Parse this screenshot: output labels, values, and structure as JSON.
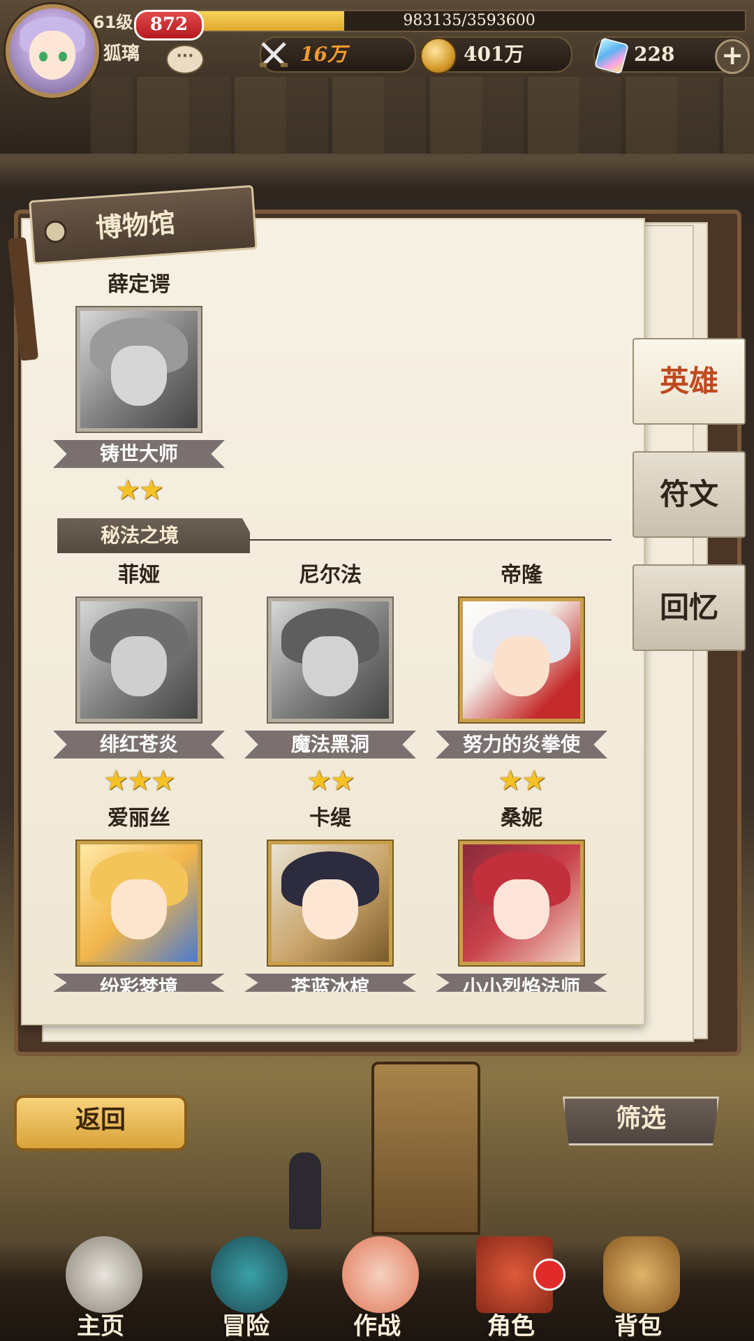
{
  "player": {
    "level": "61级",
    "power_badge": "872",
    "name": "狐璃",
    "exp_text": "983135/3593600",
    "exp_fraction": 0.2736
  },
  "resources": {
    "battle_power": "16万",
    "gold": "401万",
    "gems": "228",
    "add_label": "+"
  },
  "museum": {
    "title": "博物馆",
    "featured": {
      "name": "薛定谔",
      "title": "铸世大师",
      "stars": "★★"
    },
    "section_title": "秘法之境",
    "heroes": [
      {
        "name": "菲娅",
        "title": "绯红苍炎",
        "stars": "★★★"
      },
      {
        "name": "尼尔法",
        "title": "魔法黑洞",
        "stars": "★★"
      },
      {
        "name": "帝隆",
        "title": "努力的炎拳使",
        "stars": "★★"
      },
      {
        "name": "爱丽丝",
        "title": "纷彩梦境",
        "stars": ""
      },
      {
        "name": "卡缇",
        "title": "苍蓝冰棺",
        "stars": ""
      },
      {
        "name": "桑妮",
        "title": "小小烈焰法师",
        "stars": ""
      }
    ]
  },
  "tabs": [
    "英雄",
    "符文",
    "回忆"
  ],
  "buttons": {
    "back": "返回",
    "filter": "筛选"
  },
  "nav": [
    "主页",
    "冒险",
    "作战",
    "角色",
    "背包"
  ],
  "colors": {
    "accent_tab": "#c04a20",
    "gold": "#f5c226",
    "badge_red": "#d3262a"
  }
}
